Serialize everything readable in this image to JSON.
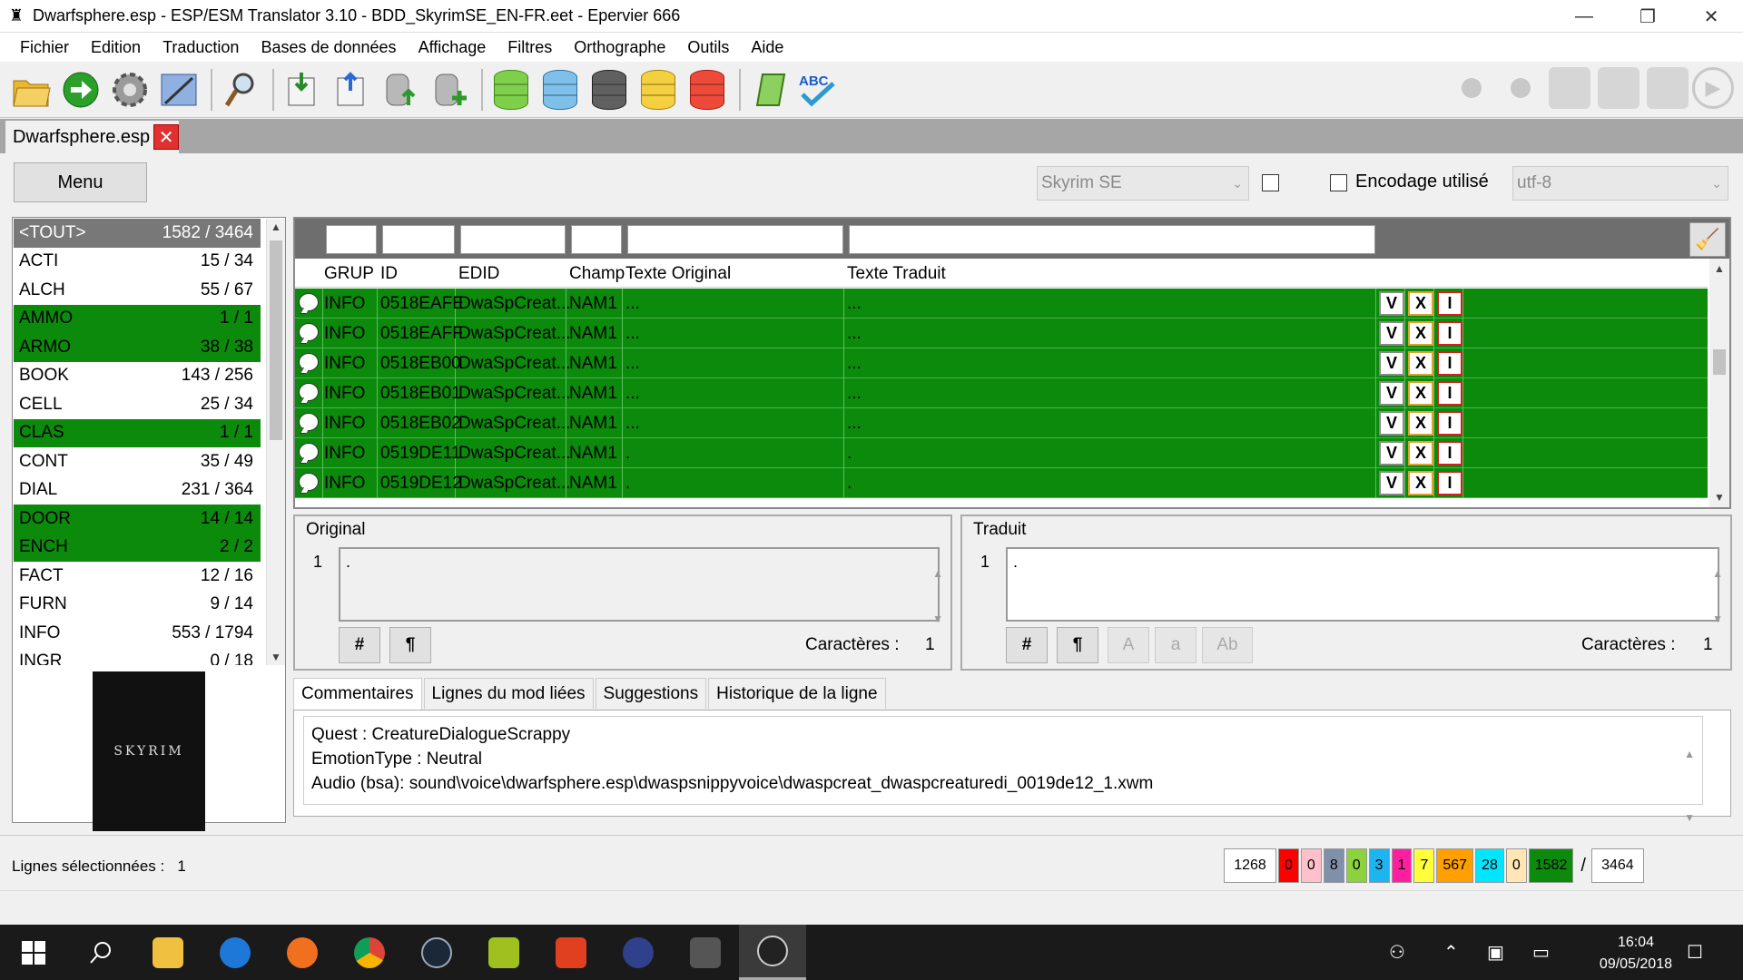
{
  "window": {
    "title": "Dwarfsphere.esp - ESP/ESM Translator 3.10 - BDD_SkyrimSE_EN-FR.eet - Epervier 666",
    "minimize": "—",
    "maximize": "❐",
    "close": "✕"
  },
  "menu": [
    "Fichier",
    "Edition",
    "Traduction",
    "Bases de données",
    "Affichage",
    "Filtres",
    "Orthographe",
    "Outils",
    "Aide"
  ],
  "doc_tab": {
    "label": "Dwarfsphere.esp",
    "close": "✕"
  },
  "controls": {
    "menu_button": "Menu",
    "game_select": "Skyrim SE",
    "encoding_label": "Encodage utilisé",
    "encoding_select": "utf-8"
  },
  "records": [
    {
      "name": "<TOUT>",
      "count": "1582 / 3464",
      "state": "sel"
    },
    {
      "name": "ACTI",
      "count": "15 / 34",
      "state": ""
    },
    {
      "name": "ALCH",
      "count": "55 / 67",
      "state": ""
    },
    {
      "name": "AMMO",
      "count": "1 / 1",
      "state": "green"
    },
    {
      "name": "ARMO",
      "count": "38 / 38",
      "state": "green"
    },
    {
      "name": "BOOK",
      "count": "143 / 256",
      "state": ""
    },
    {
      "name": "CELL",
      "count": "25 / 34",
      "state": ""
    },
    {
      "name": "CLAS",
      "count": "1 / 1",
      "state": "green"
    },
    {
      "name": "CONT",
      "count": "35 / 49",
      "state": ""
    },
    {
      "name": "DIAL",
      "count": "231 / 364",
      "state": ""
    },
    {
      "name": "DOOR",
      "count": "14 / 14",
      "state": "green"
    },
    {
      "name": "ENCH",
      "count": "2 / 2",
      "state": "green"
    },
    {
      "name": "FACT",
      "count": "12 / 16",
      "state": ""
    },
    {
      "name": "FURN",
      "count": "9 / 14",
      "state": ""
    },
    {
      "name": "INFO",
      "count": "553 / 1794",
      "state": ""
    },
    {
      "name": "INGR",
      "count": "0 / 18",
      "state": ""
    }
  ],
  "cover_art": "SKYRIM",
  "grid": {
    "headers": [
      "GRUP",
      "ID",
      "EDID",
      "Champ",
      "Texte Original",
      "Texte Traduit"
    ],
    "rows": [
      {
        "grup": "INFO",
        "id": "0518EAFE",
        "edid": "DwaSpCreat...",
        "champ": "NAM1",
        "orig": "...",
        "trad": "..."
      },
      {
        "grup": "INFO",
        "id": "0518EAFF",
        "edid": "DwaSpCreat...",
        "champ": "NAM1",
        "orig": "...",
        "trad": "..."
      },
      {
        "grup": "INFO",
        "id": "0518EB00",
        "edid": "DwaSpCreat...",
        "champ": "NAM1",
        "orig": "...",
        "trad": "..."
      },
      {
        "grup": "INFO",
        "id": "0518EB01",
        "edid": "DwaSpCreat...",
        "champ": "NAM1",
        "orig": "...",
        "trad": "..."
      },
      {
        "grup": "INFO",
        "id": "0518EB02",
        "edid": "DwaSpCreat...",
        "champ": "NAM1",
        "orig": "...",
        "trad": "..."
      },
      {
        "grup": "INFO",
        "id": "0519DE11",
        "edid": "DwaSpCreat...",
        "champ": "NAM1",
        "orig": ".",
        "trad": "."
      },
      {
        "grup": "INFO",
        "id": "0519DE12",
        "edid": "DwaSpCreat...",
        "champ": "NAM1",
        "orig": ".",
        "trad": "."
      }
    ],
    "action_labels": {
      "v": "V",
      "x": "X",
      "i": "I"
    }
  },
  "original": {
    "title": "Original",
    "line": "1",
    "text": ".",
    "btn_hash": "#",
    "btn_pilcrow": "¶",
    "chars_label": "Caractères :",
    "chars": "1"
  },
  "traduit": {
    "title": "Traduit",
    "line": "1",
    "text": ".",
    "btn_hash": "#",
    "btn_pilcrow": "¶",
    "btn_upper": "A",
    "btn_lower": "a",
    "btn_title": "Ab",
    "chars_label": "Caractères :",
    "chars": "1"
  },
  "bottom_tabs": [
    "Commentaires",
    "Lignes du mod liées",
    "Suggestions",
    "Historique de la ligne"
  ],
  "comments": [
    "Quest : CreatureDialogueScrappy",
    "EmotionType : Neutral",
    "Audio (bsa): sound\\voice\\dwarfsphere.esp\\dwaspsnippyvoice\\dwaspcreat_dwaspcreaturedi_0019de12_1.xwm"
  ],
  "status": {
    "selected_label": "Lignes sélectionnées :",
    "selected_value": "1",
    "counters": [
      {
        "value": "1268",
        "color": "#ffffff"
      },
      {
        "value": "0",
        "color": "#ff0000"
      },
      {
        "value": "0",
        "color": "#ffc0cb"
      },
      {
        "value": "8",
        "color": "#8090a8"
      },
      {
        "value": "0",
        "color": "#8cd23c"
      },
      {
        "value": "3",
        "color": "#1eb4f0"
      },
      {
        "value": "1",
        "color": "#ff1ea0"
      },
      {
        "value": "7",
        "color": "#ffff3c"
      },
      {
        "value": "567",
        "color": "#ffa000"
      },
      {
        "value": "28",
        "color": "#00e6ff"
      },
      {
        "value": "0",
        "color": "#ffe6b4"
      },
      {
        "value": "1582",
        "color": "#0b8a0b"
      }
    ],
    "separator": "/",
    "total": "3464"
  },
  "taskbar": {
    "time": "16:04",
    "date": "09/05/2018"
  }
}
